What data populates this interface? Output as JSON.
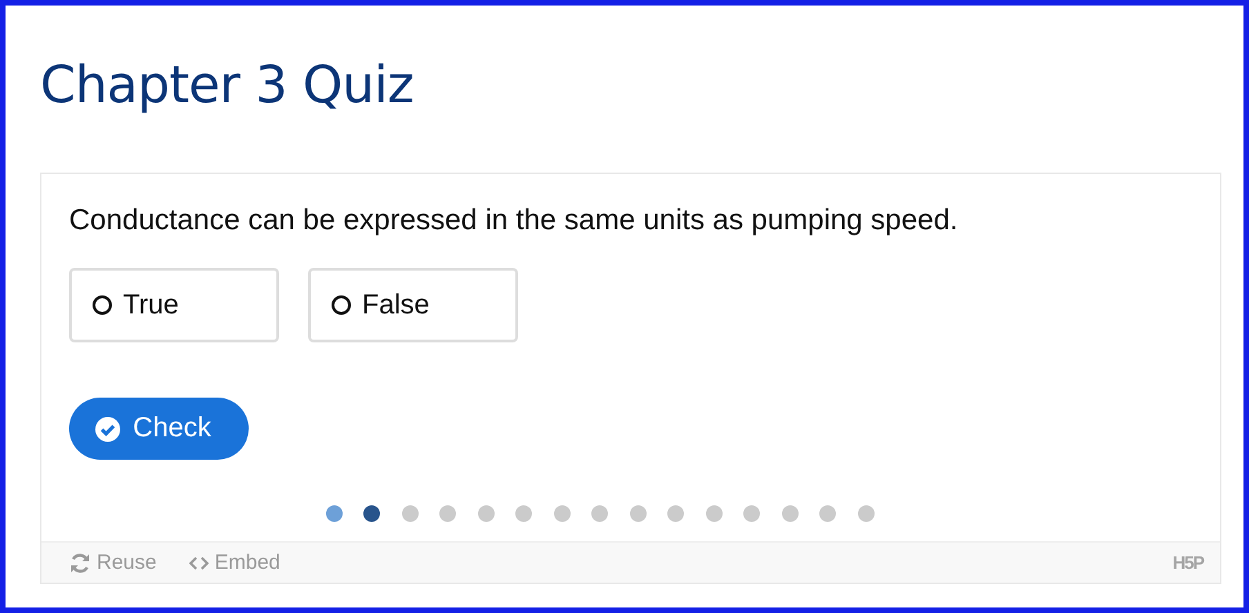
{
  "title": "Chapter 3 Quiz",
  "question": "Conductance can be expressed in the same units as pumping speed.",
  "options": [
    {
      "label": "True",
      "selected": false
    },
    {
      "label": "False",
      "selected": false
    }
  ],
  "check_button": "Check",
  "progress_dots": [
    {
      "selected": false,
      "answered": true
    },
    {
      "selected": true,
      "answered": false
    },
    {
      "selected": false,
      "answered": false
    },
    {
      "selected": false,
      "answered": false
    },
    {
      "selected": false,
      "answered": false
    },
    {
      "selected": false,
      "answered": false
    },
    {
      "selected": false,
      "answered": false
    },
    {
      "selected": false,
      "answered": false
    },
    {
      "selected": false,
      "answered": false
    },
    {
      "selected": false,
      "answered": false
    },
    {
      "selected": false,
      "answered": false
    },
    {
      "selected": false,
      "answered": false
    },
    {
      "selected": false,
      "answered": false
    },
    {
      "selected": false,
      "answered": false
    },
    {
      "selected": false,
      "answered": false
    }
  ],
  "footer": {
    "reuse": "Reuse",
    "embed": "Embed",
    "logo": "H5P"
  }
}
